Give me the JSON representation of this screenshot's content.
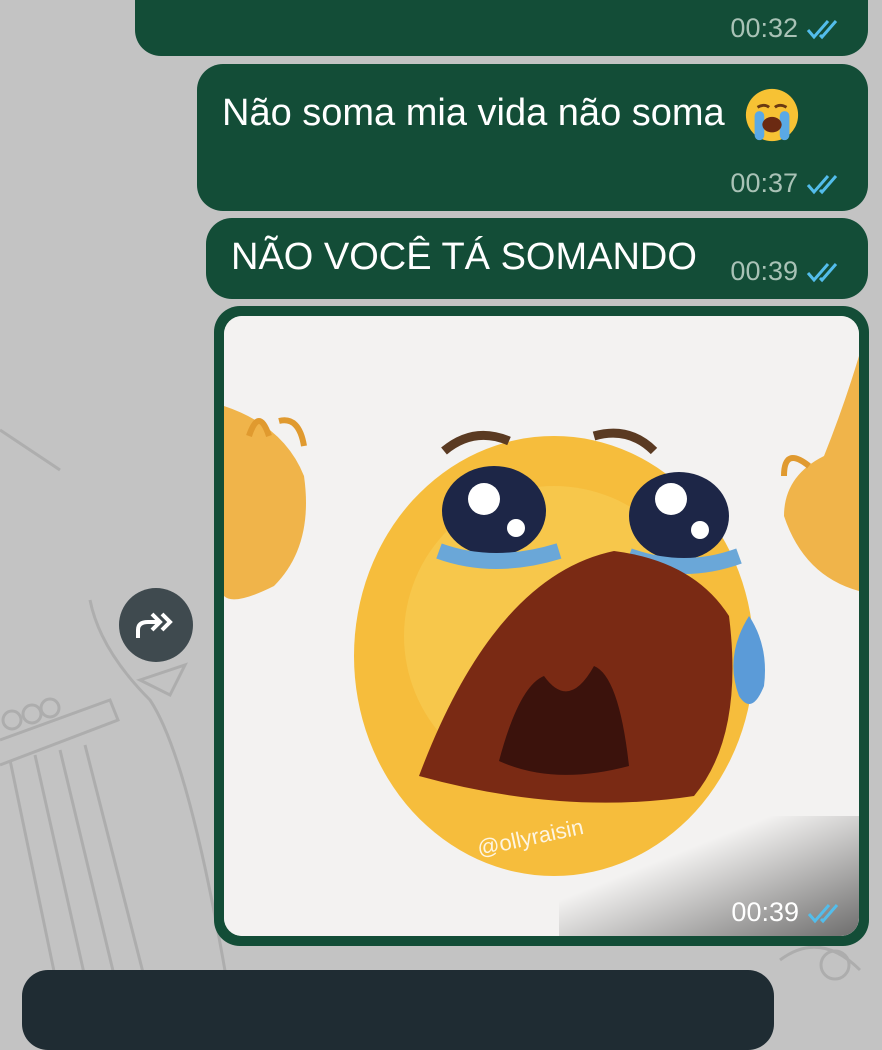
{
  "messages": [
    {
      "id": "m1",
      "text": "",
      "time": "00:32",
      "status_icon": "double-check-read-icon"
    },
    {
      "id": "m2",
      "text": "Não soma mia vida não soma",
      "emoji": "loudly-crying-face-emoji",
      "time": "00:37",
      "status_icon": "double-check-read-icon"
    },
    {
      "id": "m3",
      "text": "NÃO VOCÊ TÁ SOMANDO",
      "time": "00:39",
      "status_icon": "double-check-read-icon"
    },
    {
      "id": "m4",
      "type": "image",
      "image_desc": "crying-emoji-sticker",
      "watermark": "@ollyraisin",
      "time": "00:39",
      "status_icon": "double-check-read-icon"
    },
    {
      "id": "m5",
      "text": ""
    }
  ],
  "forward_button": {
    "icon": "forward-arrow-icon"
  },
  "colors": {
    "outgoing_bubble": "#134d37",
    "incoming_bubble": "#1f2c33",
    "tick_blue": "#53bdeb",
    "timestamp": "#a9c2b6",
    "background": "#c3c3c3"
  }
}
